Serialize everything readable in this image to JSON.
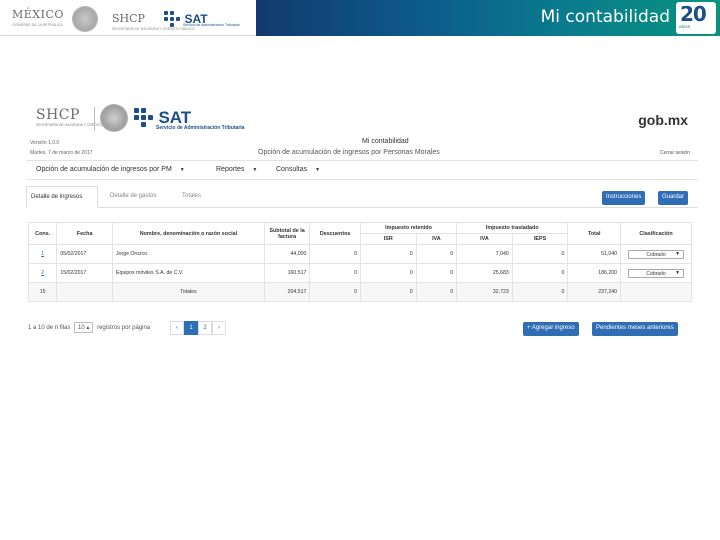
{
  "slide": {
    "title": "Mi contabilidad",
    "badge_number": "20",
    "badge_sub": "AÑOS",
    "logos": {
      "mexico": "MÉXICO",
      "mexico_sub": "GOBIERNO DE LA REPÚBLICA",
      "shcp": "SHCP",
      "shcp_sub": "SECRETARÍA DE HACIENDA Y CRÉDITO PÚBLICO",
      "sat": "SAT",
      "sat_sub": "Servicio de Administración Tributaria"
    },
    "colors": {
      "header_left": "#123a6e",
      "header_right": "#07937e",
      "primary_button": "#2f6eb5"
    }
  },
  "app": {
    "shcp": "SHCP",
    "shcp_sub": "SECRETARÍA DE HACIENDA Y CRÉDITO PÚBLICO",
    "sat": "SAT",
    "sat_sub": "Servicio de Administración Tributaria",
    "gob": "gob.mx",
    "version": "Versión 1.0.0",
    "date": "Martes, 7 de marzo de 2017",
    "title": "Mi contabilidad",
    "subtitle": "Opción de acumulación de ingresos por Personas Morales",
    "logout": "Cerrar sesión",
    "menu": {
      "option": "Opción de acumulación de ingresos por PM",
      "reports": "Reportes",
      "queries": "Consultas"
    },
    "tabs": [
      "Detalle de ingresos",
      "Detalle de gastos",
      "Totales"
    ],
    "buttons": {
      "instructions": "Instrucciones",
      "save": "Guardar",
      "add_income": "+ Agregar ingreso",
      "pending": "Pendientes meses anteriores"
    },
    "table": {
      "headers": {
        "cons": "Cons.",
        "fecha": "Fecha",
        "nombre": "Nombre, denominación o razón social",
        "subtotal": "Subtotal de la factura",
        "descuentos": "Descuentos",
        "retenido": "Impuesto retenido",
        "trasladado": "Impuesto trasladado",
        "isr": "ISR",
        "iva_r": "IVA",
        "iva_t": "IVA",
        "ieps": "IEPS",
        "total": "Total",
        "clasificacion": "Clasificación"
      },
      "rows": [
        {
          "cons": "1",
          "fecha": "05/02/2017",
          "nombre": "Jorge Orozco",
          "subtotal": "44,000",
          "descuentos": "0",
          "isr": "0",
          "iva_r": "0",
          "iva_t": "7,040",
          "ieps": "0",
          "total": "51,040",
          "clasificacion": "Cobrado"
        },
        {
          "cons": "2",
          "fecha": "15/02/2017",
          "nombre": "Equipos móviles S.A. de C.V.",
          "subtotal": "160,517",
          "descuentos": "0",
          "isr": "0",
          "iva_r": "0",
          "iva_t": "25,683",
          "ieps": "0",
          "total": "186,200",
          "clasificacion": "Cobrado"
        }
      ],
      "totals": {
        "cons": "15",
        "label": "Totales",
        "subtotal": "204,517",
        "descuentos": "0",
        "isr": "0",
        "iva_r": "0",
        "iva_t": "32,723",
        "ieps": "0",
        "total": "237,240"
      }
    },
    "pager": {
      "info_prefix": "1 a 10 de n filas",
      "page_size": "10",
      "info_suffix": "registros por página",
      "prev": "‹",
      "pages": [
        "1",
        "2"
      ],
      "next": "›"
    }
  }
}
